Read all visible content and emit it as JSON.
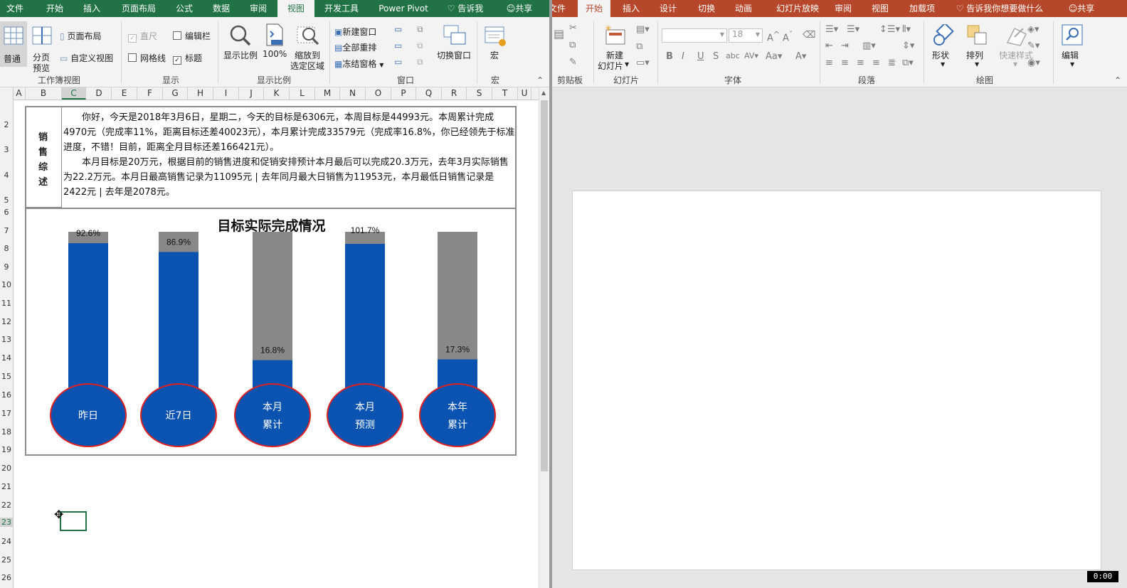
{
  "excel": {
    "tabs": [
      "文件",
      "开始",
      "插入",
      "页面布局",
      "公式",
      "数据",
      "审阅",
      "视图",
      "开发工具",
      "Power Pivot"
    ],
    "active_tab": "视图",
    "tell_me": "告诉我",
    "share": "共享",
    "ribbon": {
      "normal": "普通",
      "page_break_l1": "分页",
      "page_break_l2": "预览",
      "page_layout": "页面布局",
      "custom_view": "自定义视图",
      "group_workbook_views": "工作簿视图",
      "ruler": "直尺",
      "formula_bar": "编辑栏",
      "gridlines": "网格线",
      "headings": "标题",
      "group_show": "显示",
      "zoom": "显示比例",
      "zoom_100": "100%",
      "zoom_sel_l1": "缩放到",
      "zoom_sel_l2": "选定区域",
      "group_zoom": "显示比例",
      "new_window": "新建窗口",
      "arrange_all": "全部重排",
      "freeze_panes": "冻结窗格",
      "switch_window": "切换窗口",
      "group_window": "窗口",
      "macros": "宏",
      "group_macros": "宏"
    },
    "columns": [
      "A",
      "B",
      "C",
      "D",
      "E",
      "F",
      "G",
      "H",
      "I",
      "J",
      "K",
      "L",
      "M",
      "N",
      "O",
      "P",
      "Q",
      "R",
      "S",
      "T",
      "U"
    ],
    "rows": [
      "2",
      "3",
      "4",
      "5",
      "6",
      "7",
      "8",
      "9",
      "10",
      "11",
      "12",
      "13",
      "14",
      "15",
      "16",
      "17",
      "18",
      "19",
      "20",
      "21",
      "22",
      "23",
      "24",
      "25",
      "26"
    ],
    "selected_column": "C",
    "selected_row": "23",
    "sales_title": [
      "销",
      "售",
      "综",
      "述"
    ],
    "sales_p1": "你好，今天是2018年3月6日，星期二，今天的目标是6306元，本周目标是44993元。本周累计完成4970元（完成率11%，距离目标还差40023元），本月累计完成33579元（完成率16.8%，你已经领先于标准进度，不错！目前，距离全月目标还差166421元）。",
    "sales_p2": "本月目标是20万元，根据目前的销售进度和促销安排预计本月最后可以完成20.3万元，去年3月实际销售为22.2万元。本月日最高销售记录为11095元 | 去年同月最大日销售为11953元，本月最低日销售记录是2422元 | 去年是2078元。"
  },
  "chart_data": {
    "type": "bar",
    "title": "目标实际完成情况",
    "categories": [
      [
        "昨日"
      ],
      [
        "近7日"
      ],
      [
        "本月",
        "累计"
      ],
      [
        "本月",
        "预测"
      ],
      [
        "本年",
        "累计"
      ]
    ],
    "values": [
      92.6,
      86.9,
      16.8,
      101.7,
      17.3
    ],
    "labels": [
      "92.6%",
      "86.9%",
      "16.8%",
      "101.7%",
      "17.3%"
    ],
    "ylim": [
      0,
      100
    ],
    "colors": {
      "fill": "#0a53b0",
      "track": "#888888",
      "bulb_border": "#e02020"
    }
  },
  "ppt": {
    "tabs": [
      "文件",
      "开始",
      "插入",
      "设计",
      "切换",
      "动画",
      "幻灯片放映",
      "审阅",
      "视图",
      "加载项"
    ],
    "active_tab": "开始",
    "tell_me": "告诉我你想要做什么",
    "share": "共享",
    "ribbon": {
      "clipboard_group": "剪贴板",
      "new_slide_l1": "新建",
      "new_slide_l2": "幻灯片",
      "slides_group": "幻灯片",
      "font_size": "18",
      "font_group": "字体",
      "paragraph_group": "段落",
      "shapes": "形状",
      "arrange": "排列",
      "quick_styles": "快速样式",
      "drawing_group": "绘图",
      "edit": "编辑"
    },
    "timer": "0:00"
  }
}
